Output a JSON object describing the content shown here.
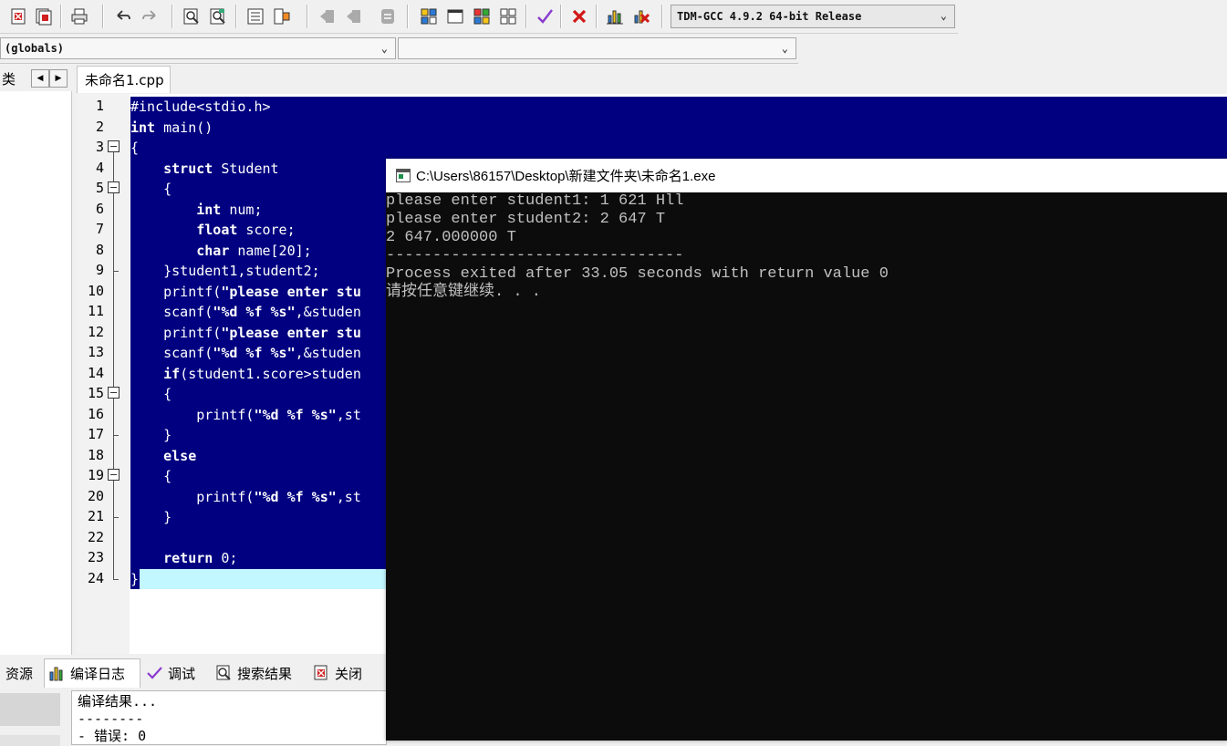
{
  "toolbar": {
    "compiler": "TDM-GCC 4.9.2 64-bit Release"
  },
  "scope_selectors": {
    "scope": "(globals)",
    "member": ""
  },
  "left_panel": {
    "tab_label": "类"
  },
  "editor": {
    "file_tab": "未命名1.cpp",
    "lines": [
      {
        "num": "1",
        "text": "#include<stdio.h>"
      },
      {
        "num": "2",
        "text": "int main()"
      },
      {
        "num": "3",
        "text": "{"
      },
      {
        "num": "4",
        "text": "    struct Student"
      },
      {
        "num": "5",
        "text": "    {"
      },
      {
        "num": "6",
        "text": "        int num;"
      },
      {
        "num": "7",
        "text": "        float score;"
      },
      {
        "num": "8",
        "text": "        char name[20];"
      },
      {
        "num": "9",
        "text": "    }student1,student2;"
      },
      {
        "num": "10",
        "text": "    printf(\"please enter stu"
      },
      {
        "num": "11",
        "text": "    scanf(\"%d %f %s\",&studen"
      },
      {
        "num": "12",
        "text": "    printf(\"please enter stu"
      },
      {
        "num": "13",
        "text": "    scanf(\"%d %f %s\",&studen"
      },
      {
        "num": "14",
        "text": "    if(student1.score>studen"
      },
      {
        "num": "15",
        "text": "    {"
      },
      {
        "num": "16",
        "text": "        printf(\"%d %f %s\",st"
      },
      {
        "num": "17",
        "text": "    }"
      },
      {
        "num": "18",
        "text": "    else"
      },
      {
        "num": "19",
        "text": "    {"
      },
      {
        "num": "20",
        "text": "        printf(\"%d %f %s\",st"
      },
      {
        "num": "21",
        "text": "    }"
      },
      {
        "num": "22",
        "text": ""
      },
      {
        "num": "23",
        "text": "    return 0;"
      },
      {
        "num": "24",
        "text": "}"
      }
    ]
  },
  "bottom_panel": {
    "tabs": [
      {
        "label": "资源"
      },
      {
        "label": "编译日志"
      },
      {
        "label": "调试"
      },
      {
        "label": "搜索结果"
      },
      {
        "label": "关闭"
      }
    ],
    "log_lines": [
      "编译结果...",
      "--------",
      "- 错误: 0"
    ]
  },
  "console": {
    "title": "C:\\Users\\86157\\Desktop\\新建文件夹\\未命名1.exe",
    "lines": [
      "please enter student1: 1 621 Hll",
      "please enter student2: 2 647 T",
      "2 647.000000 T",
      "--------------------------------",
      "Process exited after 33.05 seconds with return value 0",
      "请按任意键继续. . ."
    ]
  },
  "colors": {
    "selection": "#000080",
    "current_line": "#c2f7ff",
    "console_bg": "#0c0c0c",
    "console_text": "#c0c0c0"
  }
}
